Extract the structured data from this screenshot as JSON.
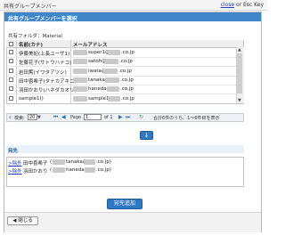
{
  "window": {
    "title": "共有グループメンバー",
    "close_link": "close",
    "close_suffix": " or Esc Key"
  },
  "dialog": {
    "header": "共有グループメンバーを選択",
    "folder_label": "共有フォルダ：Material"
  },
  "table": {
    "columns": [
      "名前(カナ)",
      "メールアドレス"
    ],
    "rows": [
      {
        "name": "伊藤美紀(上長ユーザ1)",
        "email_prefix": "super1@",
        "email_suffix": ".co.jp"
      },
      {
        "name": "佐藤花子(サトウハナコ)",
        "email_prefix": "satoh@",
        "email_suffix": ".co.jp"
      },
      {
        "name": "岩田篤(イワタアツシ)",
        "email_prefix": "iwata@",
        "email_suffix": ".co.jp"
      },
      {
        "name": "田中喜希子(タナカアキコ)",
        "email_prefix": "tanaka@",
        "email_suffix": ".co.jp"
      },
      {
        "name": "羽田かおり(ハネダカオリ)",
        "email_prefix": "haneda@",
        "email_suffix": ".co.jp"
      },
      {
        "name": "sample1()",
        "email_prefix": "sample1@",
        "email_suffix": ".co.jp"
      }
    ]
  },
  "pager": {
    "search_label": "検索:",
    "page_size": "20",
    "page_label": "Page",
    "page_value": "1",
    "of_label": "of 1",
    "summary": "合計6件のうち、1～6件目を表示"
  },
  "destination": {
    "label": "宛先",
    "items": [
      {
        "remove": ">除外",
        "name": "田中喜希子",
        "email_prefix": "tanaka@",
        "email_suffix": ".co.jp)"
      },
      {
        "remove": ">除外",
        "name": "羽田かおり",
        "email_prefix": "haneda@",
        "email_suffix": ".co.jp)"
      }
    ]
  },
  "buttons": {
    "add": "宛先追加",
    "close": "閉じる"
  },
  "icons": {
    "move_down": "arrow-down-icon",
    "first": "first-page-icon",
    "prev": "prev-page-icon",
    "next": "next-page-icon",
    "last": "last-page-icon",
    "refresh": "refresh-icon",
    "close_btn": "back-arrow-icon"
  },
  "colors": {
    "header": "#3f87c9",
    "button": "#2f78c4",
    "link": "#1a3fb0"
  }
}
